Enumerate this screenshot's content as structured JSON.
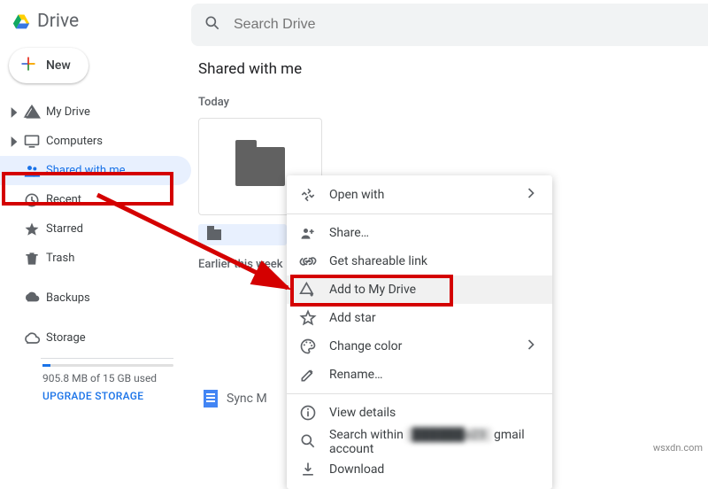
{
  "brand": {
    "name": "Drive"
  },
  "new_button": {
    "label": "New"
  },
  "search": {
    "placeholder": "Search Drive"
  },
  "sidebar": {
    "items": [
      {
        "label": "My Drive",
        "expandable": true
      },
      {
        "label": "Computers",
        "expandable": true
      },
      {
        "label": "Shared with me"
      },
      {
        "label": "Recent"
      },
      {
        "label": "Starred"
      },
      {
        "label": "Trash"
      }
    ],
    "backups": {
      "label": "Backups"
    },
    "storage": {
      "label": "Storage",
      "used": "905.8 MB of 15 GB used",
      "upgrade": "UPGRADE STORAGE"
    }
  },
  "main": {
    "title": "Shared with me",
    "group_today": "Today",
    "group_earlier": "Earlier this week",
    "doc_name": "Sync M"
  },
  "context_menu": {
    "open_with": "Open with",
    "share": "Share…",
    "get_link": "Get shareable link",
    "add_drive": "Add to My Drive",
    "add_star": "Add star",
    "change_color": "Change color",
    "rename": "Rename…",
    "view_details": "View details",
    "search_within_pre": "Search within",
    "search_within_obscured": "██████o23",
    "search_within_post": "gmail account",
    "download": "Download"
  },
  "watermark": "wsxdn.com"
}
